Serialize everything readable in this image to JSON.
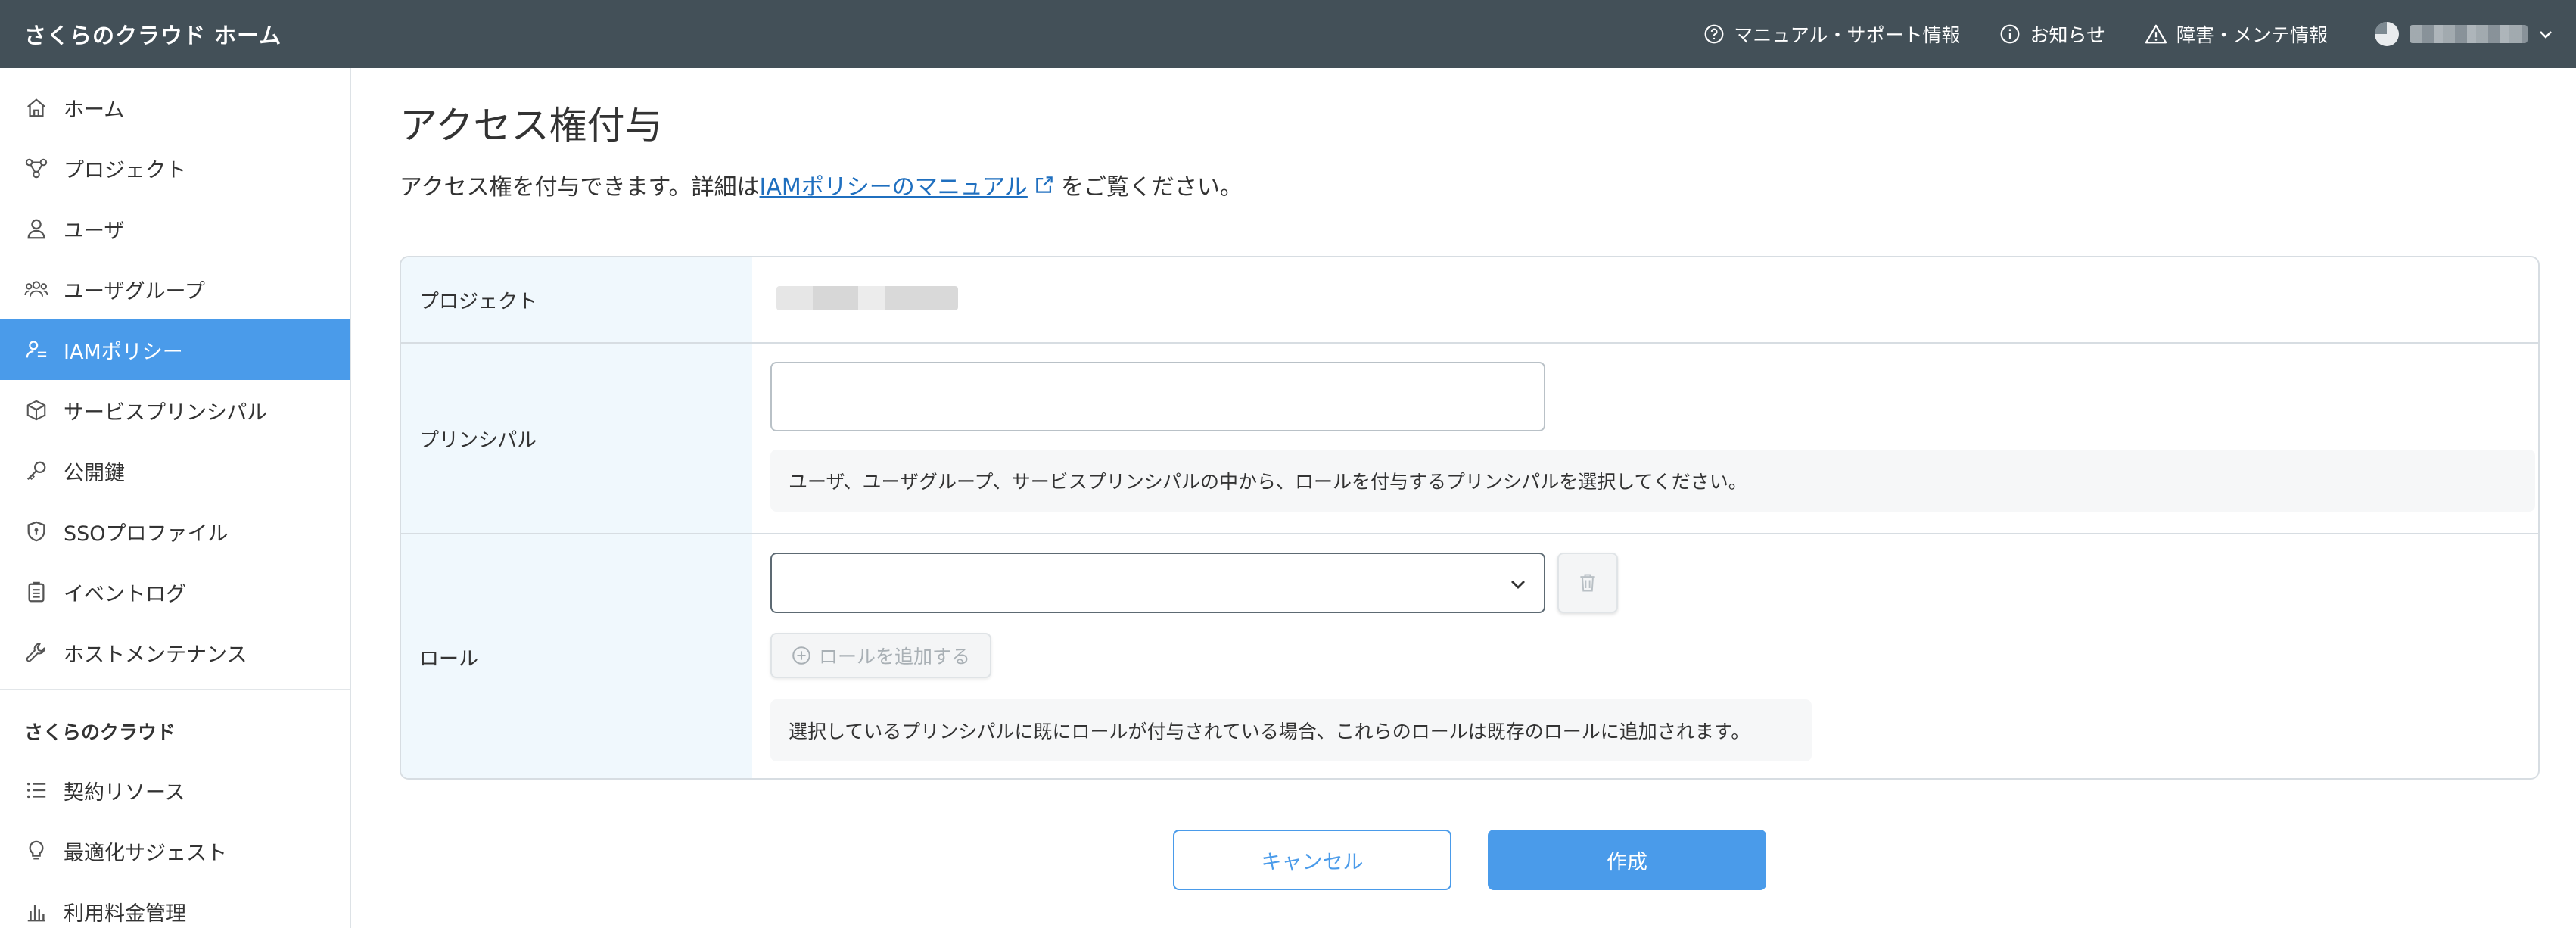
{
  "header": {
    "brand": "さくらのクラウド ホーム",
    "nav": [
      {
        "label": "マニュアル・サポート情報",
        "icon": "help-circle-icon"
      },
      {
        "label": "お知らせ",
        "icon": "info-circle-icon"
      },
      {
        "label": "障害・メンテ情報",
        "icon": "warning-triangle-icon"
      }
    ]
  },
  "sidebar": {
    "items": [
      {
        "label": "ホーム",
        "icon": "home-icon"
      },
      {
        "label": "プロジェクト",
        "icon": "project-nodes-icon"
      },
      {
        "label": "ユーザ",
        "icon": "user-icon"
      },
      {
        "label": "ユーザグループ",
        "icon": "user-group-icon"
      },
      {
        "label": "IAMポリシー",
        "icon": "iam-policy-icon",
        "active": true
      },
      {
        "label": "サービスプリンシパル",
        "icon": "cube-icon"
      },
      {
        "label": "公開鍵",
        "icon": "key-icon"
      },
      {
        "label": "SSOプロファイル",
        "icon": "shield-icon"
      },
      {
        "label": "イベントログ",
        "icon": "clipboard-icon"
      },
      {
        "label": "ホストメンテナンス",
        "icon": "wrench-icon"
      }
    ],
    "section_title": "さくらのクラウド",
    "section_items": [
      {
        "label": "契約リソース",
        "icon": "list-icon"
      },
      {
        "label": "最適化サジェスト",
        "icon": "lightbulb-icon"
      },
      {
        "label": "利用料金管理",
        "icon": "bar-chart-icon"
      }
    ]
  },
  "main": {
    "title": "アクセス権付与",
    "desc_prefix": "アクセス権を付与できます。詳細は",
    "desc_link": "IAMポリシーのマニュアル",
    "desc_suffix": "をご覧ください。",
    "form": {
      "project_label": "プロジェクト",
      "principal_label": "プリンシパル",
      "principal_value": "",
      "principal_help": "ユーザ、ユーザグループ、サービスプリンシパルの中から、ロールを付与するプリンシパルを選択してください。",
      "role_label": "ロール",
      "role_selected": "",
      "add_role_label": "ロールを追加する",
      "role_help": "選択しているプリンシパルに既にロールが付与されている場合、これらのロールは既存のロールに追加されます。"
    },
    "buttons": {
      "cancel": "キャンセル",
      "create": "作成"
    }
  },
  "colors": {
    "header_bg": "#435058",
    "accent": "#4a9bea",
    "label_bg": "#f0f8fd",
    "link": "#1f6fbf"
  }
}
